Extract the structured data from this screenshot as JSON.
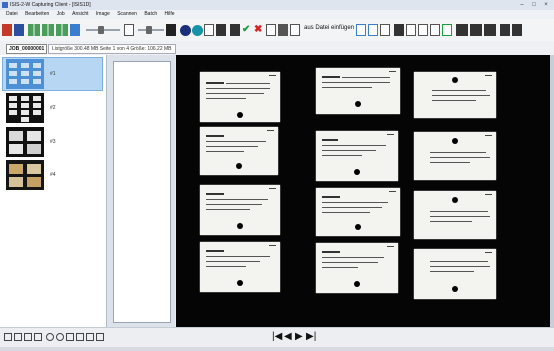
{
  "window": {
    "title": "ISIS-2-W Capturing Client - [ISIS1D]"
  },
  "menu": [
    "Datei",
    "Bearbeiten",
    "Job",
    "Ansicht",
    "Image",
    "Scannen",
    "Batch",
    "Hilfe"
  ],
  "toolbar": {
    "insert_label": "aus Datei einfügen",
    "colors": {
      "circle_dark": "#1b2f7a",
      "circle_teal": "#1793a6",
      "check": "#1d9e3f",
      "cross": "#d92323",
      "accent": "#3d7fd0"
    }
  },
  "jobbar": {
    "job_id": "JOB_00000001",
    "info": "Listgröße 300.48 MB Seite 1 von 4 Größe: 106.22 MB"
  },
  "thumbnails": [
    {
      "label": "#1",
      "selected": true
    },
    {
      "label": "#2",
      "selected": false
    },
    {
      "label": "#3",
      "selected": false
    },
    {
      "label": "#4",
      "selected": false
    }
  ],
  "navigation": {
    "first": "|◀",
    "prev": "◀",
    "next": "▶",
    "last": "▶|"
  },
  "bottom_icons": [
    "page-icon",
    "page-icon",
    "page-icon",
    "page-icon",
    "zoom-in-icon",
    "zoom-out-icon",
    "fit-icon",
    "fit-icon",
    "fit-icon",
    "fit-icon"
  ]
}
